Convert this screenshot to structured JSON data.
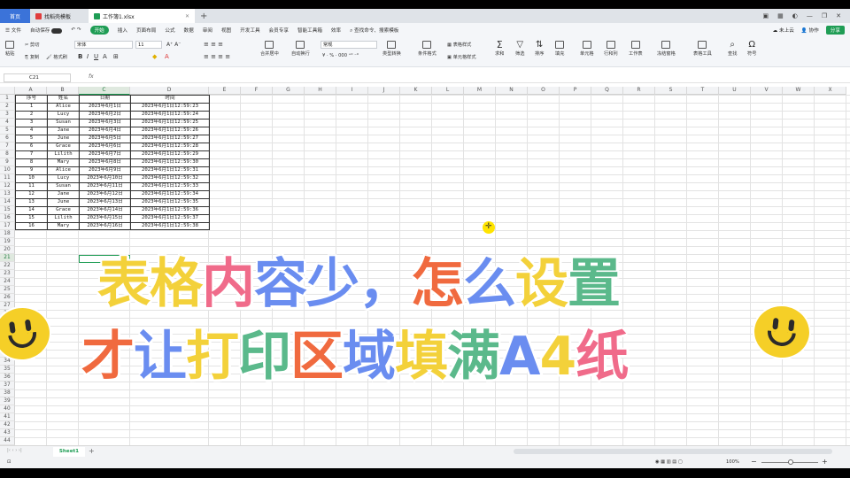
{
  "tabs": {
    "home": "首页",
    "template": "找稻壳模板",
    "doc": "工作簿1.xlsx"
  },
  "menu": {
    "file": "文件",
    "autosave": "自动保存",
    "items": [
      "开始",
      "插入",
      "页面布局",
      "公式",
      "数据",
      "审阅",
      "视图",
      "开发工具",
      "会员专享",
      "智能工具箱",
      "效率"
    ],
    "search": "查找命令、搜索模板",
    "cloud": "未上云",
    "collab": "协作",
    "share": "分享"
  },
  "ribbon": {
    "paste": "粘贴",
    "cut": "剪切",
    "copy": "复制",
    "format_painter": "格式刷",
    "font": "宋体",
    "size": "11",
    "merge": "合并居中",
    "wrap": "自动换行",
    "numfmt": "常规",
    "convert": "类型转换",
    "cond": "条件格式",
    "tablestyle": "表格样式",
    "cellstyle": "单元格样式",
    "sum": "求和",
    "filter": "筛选",
    "sort": "排序",
    "fill": "填充",
    "cell": "单元格",
    "rowcol": "行和列",
    "sheet": "工作表",
    "freeze": "冻结窗格",
    "tabletools": "表格工具",
    "find": "查找",
    "symbol": "符号"
  },
  "formula": {
    "cell_ref": "C21",
    "fx": "fx"
  },
  "columns": [
    "A",
    "B",
    "C",
    "D",
    "E",
    "F",
    "G",
    "H",
    "I",
    "J",
    "K",
    "L",
    "M",
    "N",
    "O",
    "P",
    "Q",
    "R",
    "S",
    "T",
    "U",
    "V",
    "W",
    "X"
  ],
  "rows_count": 44,
  "table": {
    "headers": [
      "序号",
      "姓名",
      "日期",
      "时间"
    ],
    "rows": [
      [
        "1",
        "Alice",
        "2023年6月1日",
        "2023年6月1日12:59:23"
      ],
      [
        "2",
        "Lucy",
        "2023年6月2日",
        "2023年6月1日12:59:24"
      ],
      [
        "3",
        "Susan",
        "2023年6月3日",
        "2023年6月1日12:59:25"
      ],
      [
        "4",
        "Jane",
        "2023年6月4日",
        "2023年6月1日12:59:26"
      ],
      [
        "5",
        "June",
        "2023年6月5日",
        "2023年6月1日12:59:27"
      ],
      [
        "6",
        "Grace",
        "2023年6月6日",
        "2023年6月1日12:59:28"
      ],
      [
        "7",
        "Lilith",
        "2023年6月7日",
        "2023年6月1日12:59:29"
      ],
      [
        "8",
        "Mary",
        "2023年6月8日",
        "2023年6月1日12:59:30"
      ],
      [
        "9",
        "Alice",
        "2023年6月9日",
        "2023年6月1日12:59:31"
      ],
      [
        "10",
        "Lucy",
        "2023年6月10日",
        "2023年6月1日12:59:32"
      ],
      [
        "11",
        "Susan",
        "2023年6月11日",
        "2023年6月1日12:59:33"
      ],
      [
        "12",
        "Jane",
        "2023年6月12日",
        "2023年6月1日12:59:34"
      ],
      [
        "13",
        "June",
        "2023年6月13日",
        "2023年6月1日12:59:35"
      ],
      [
        "14",
        "Grace",
        "2023年6月14日",
        "2023年6月1日12:59:36"
      ],
      [
        "15",
        "Lilith",
        "2023年6月15日",
        "2023年6月1日12:59:37"
      ],
      [
        "16",
        "Mary",
        "2023年6月16日",
        "2023年6月1日12:59:38"
      ]
    ]
  },
  "overlay": {
    "line1": [
      {
        "t": "表",
        "c": "#f3d13a"
      },
      {
        "t": "格",
        "c": "#f3d13a"
      },
      {
        "t": "内",
        "c": "#f06b8a"
      },
      {
        "t": "容",
        "c": "#6a8df0"
      },
      {
        "t": "少",
        "c": "#6a8df0"
      },
      {
        "t": "，",
        "c": "#6a8df0"
      },
      {
        "t": "怎",
        "c": "#f06a3f"
      },
      {
        "t": "么",
        "c": "#6a8df0"
      },
      {
        "t": "设",
        "c": "#f3d13a"
      },
      {
        "t": "置",
        "c": "#5bb98b"
      }
    ],
    "line2": [
      {
        "t": "才",
        "c": "#f06a3f"
      },
      {
        "t": "让",
        "c": "#6a8df0"
      },
      {
        "t": "打",
        "c": "#f3d13a"
      },
      {
        "t": "印",
        "c": "#5bb98b"
      },
      {
        "t": "区",
        "c": "#f06a3f"
      },
      {
        "t": "域",
        "c": "#6a8df0"
      },
      {
        "t": "填",
        "c": "#f3d13a"
      },
      {
        "t": "满",
        "c": "#5bb98b"
      },
      {
        "t": "A",
        "c": "#6a8df0"
      },
      {
        "t": "4",
        "c": "#f3d13a"
      },
      {
        "t": "纸",
        "c": "#f06b8a"
      }
    ]
  },
  "sheet": {
    "name": "Sheet1"
  },
  "status": {
    "zoom": "100%"
  }
}
